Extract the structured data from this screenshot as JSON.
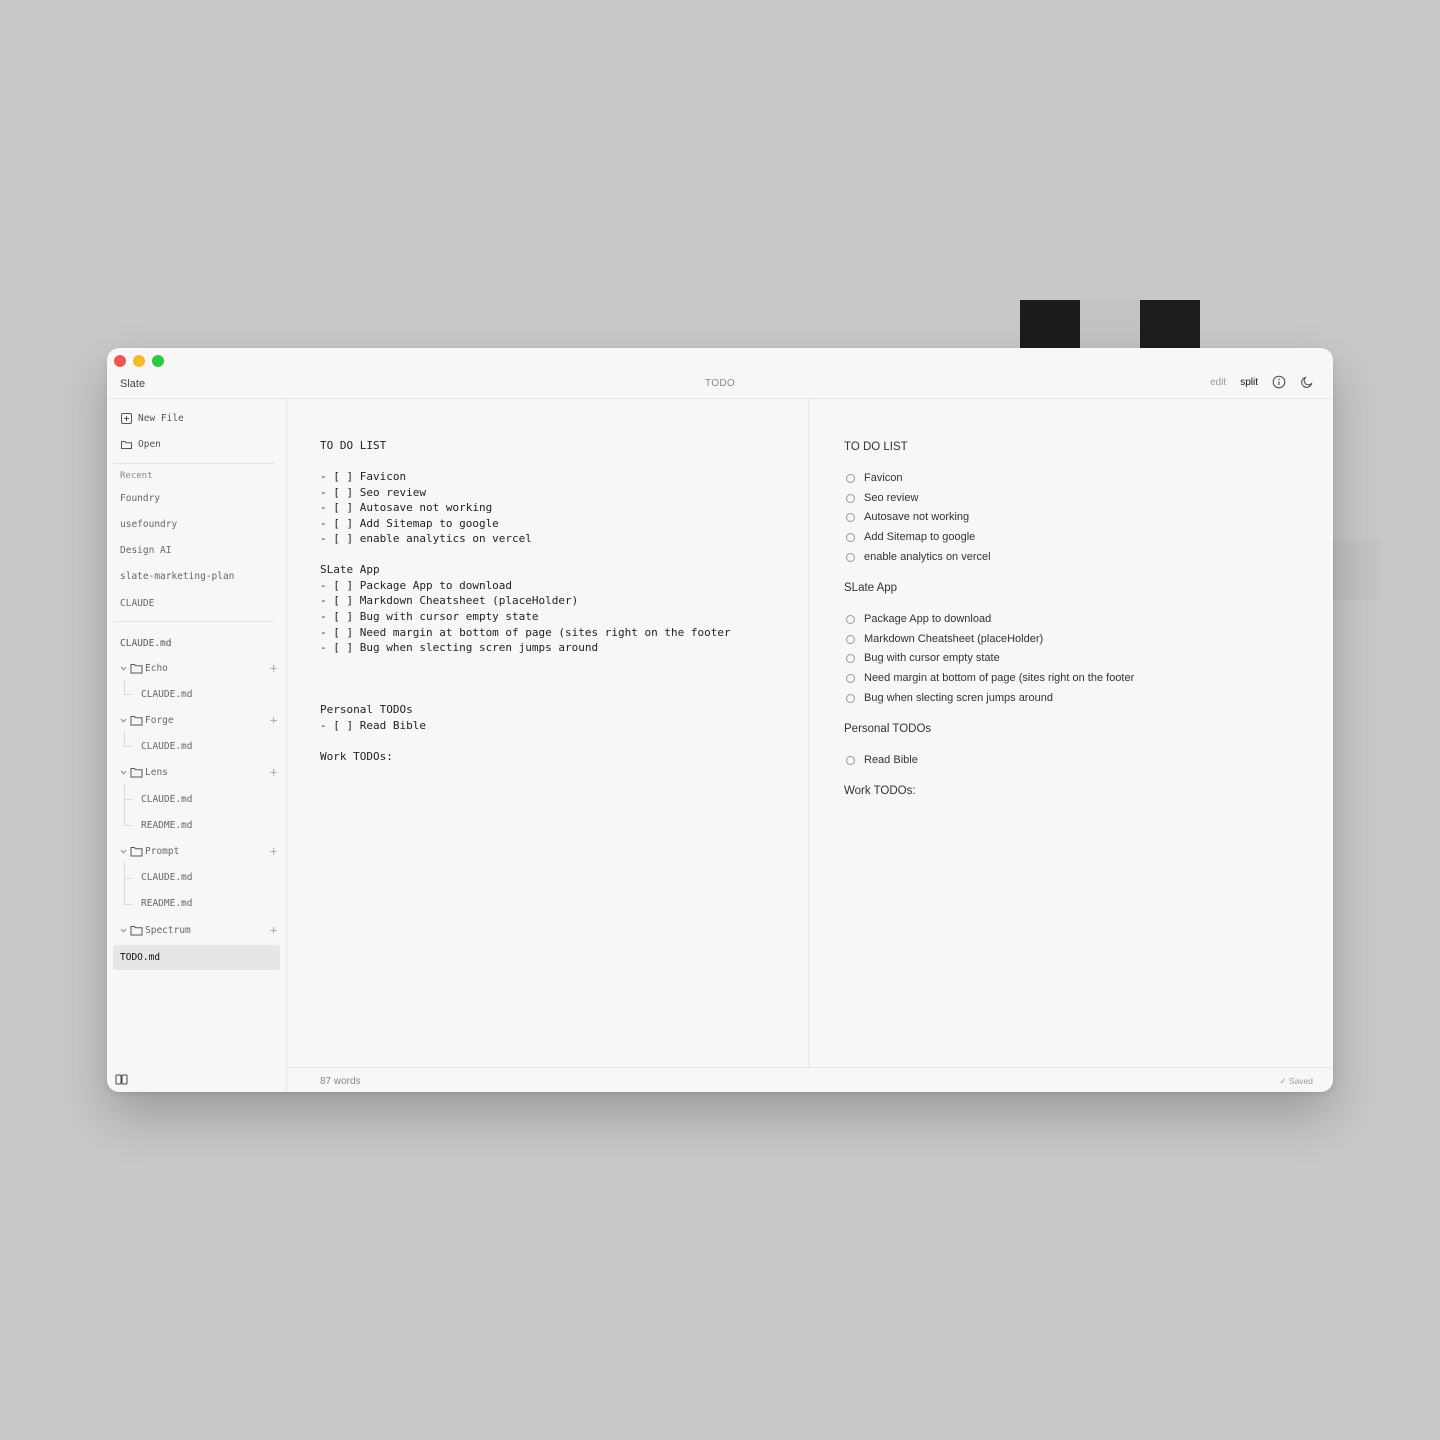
{
  "colors": {
    "background": "#c8c8c6",
    "window": "#f7f7f5",
    "close": "#ee5a52",
    "minimize": "#f3bb2a",
    "maximize": "#2fc843",
    "swatches": [
      "#1c1c1c",
      "#c3c3c1",
      "#1e1e1e"
    ]
  },
  "window": {
    "app_name": "Slate",
    "doc_title": "TODO",
    "modes": {
      "edit": "edit",
      "split": "split",
      "active": "split"
    },
    "icons": [
      "info-icon",
      "moon-icon"
    ]
  },
  "sidebar": {
    "new_file": "New File",
    "open": "Open",
    "recent_label": "Recent",
    "recent": [
      "Foundry",
      "usefoundry",
      "Design AI",
      "slate-marketing-plan",
      "CLAUDE"
    ],
    "root_file": "CLAUDE.md",
    "folders": [
      {
        "name": "Echo",
        "children": [
          "CLAUDE.md"
        ]
      },
      {
        "name": "Forge",
        "children": [
          "CLAUDE.md"
        ]
      },
      {
        "name": "Lens",
        "children": [
          "CLAUDE.md",
          "README.md"
        ]
      },
      {
        "name": "Prompt",
        "children": [
          "CLAUDE.md",
          "README.md"
        ]
      },
      {
        "name": "Spectrum",
        "children": []
      }
    ],
    "active_file": "TODO.md"
  },
  "editor": {
    "lines": [
      "TO DO LIST",
      "- [ ] Favicon",
      "- [ ] Seo review",
      "- [ ] Autosave not working",
      "- [ ] Add Sitemap to google",
      "- [ ] enable analytics on vercel",
      "SLate App",
      "- [ ] Package App to download",
      "- [ ] Markdown Cheatsheet (placeHolder)",
      "- [ ] Bug with cursor empty state",
      "- [ ] Need margin at bottom of page (sites right on the footer",
      "- [ ] Bug when slecting scren jumps around",
      "Personal TODOs",
      "- [ ] Read Bible",
      "Work TODOs:"
    ]
  },
  "preview": {
    "h1": "TO DO LIST",
    "list1": [
      "Favicon",
      "Seo review",
      "Autosave not working",
      "Add Sitemap to google",
      "enable analytics on vercel"
    ],
    "h2": "SLate App",
    "list2": [
      "Package App to download",
      "Markdown Cheatsheet (placeHolder)",
      "Bug with cursor empty state",
      "Need margin at bottom of page (sites right on the footer",
      "Bug when slecting scren jumps around"
    ],
    "h3": "Personal TODOs",
    "list3": [
      "Read Bible"
    ],
    "h4": "Work TODOs:"
  },
  "footer": {
    "word_count": "87 words",
    "status": "✓ Saved"
  }
}
